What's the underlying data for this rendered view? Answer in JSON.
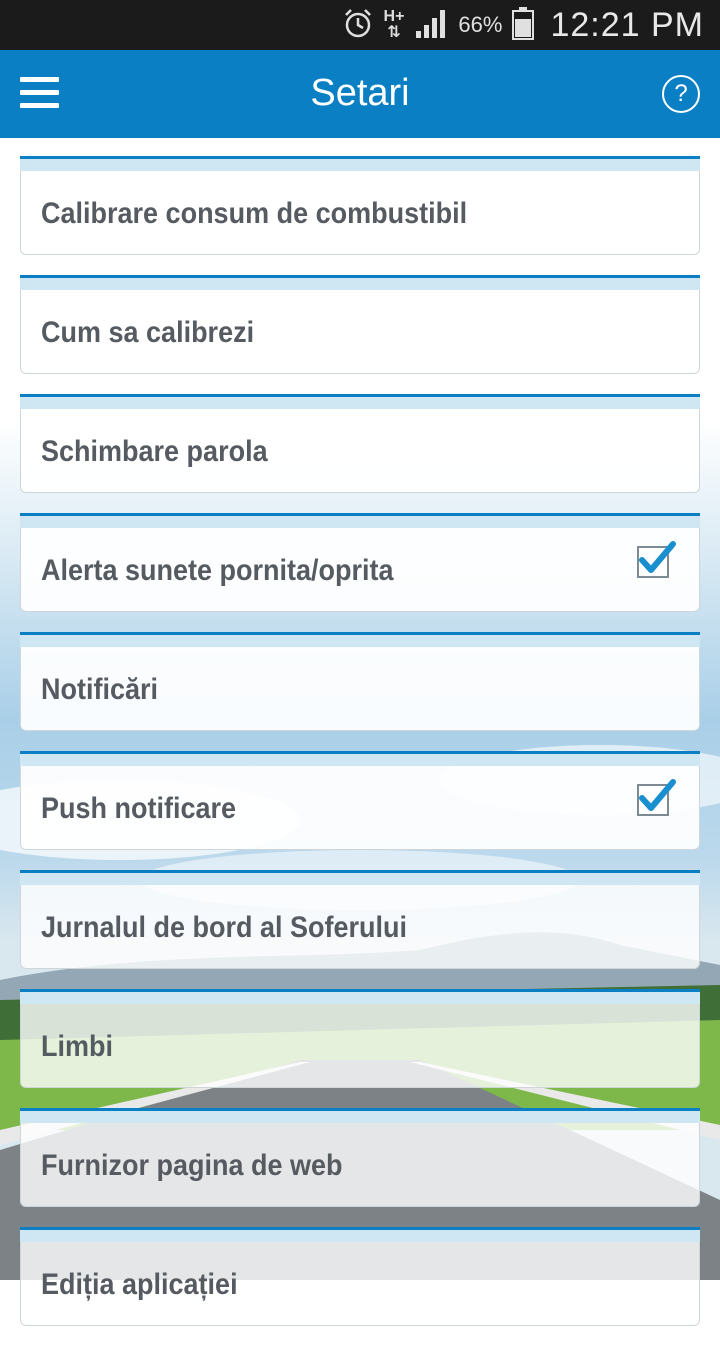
{
  "status_bar": {
    "network": "H+",
    "battery_percent": "66%",
    "time": "12:21 PM",
    "icons": [
      "alarm-icon",
      "network-icon",
      "signal-icon",
      "battery-icon"
    ]
  },
  "app_bar": {
    "title": "Setari",
    "help_symbol": "?",
    "accent_color": "#0a7fc3"
  },
  "settings": [
    {
      "label": "Calibrare consum de combustibil",
      "checkbox": null
    },
    {
      "label": "Cum sa calibrezi",
      "checkbox": null
    },
    {
      "label": "Schimbare parola",
      "checkbox": null
    },
    {
      "label": "Alerta sunete pornita/oprita",
      "checkbox": true
    },
    {
      "label": "Notificări",
      "checkbox": null
    },
    {
      "label": "Push notificare",
      "checkbox": true
    },
    {
      "label": "Jurnalul de bord al Soferului",
      "checkbox": null
    },
    {
      "label": "Limbi",
      "checkbox": null
    },
    {
      "label": "Furnizor pagina de web",
      "checkbox": null
    },
    {
      "label": "Ediția aplicației",
      "checkbox": null
    }
  ]
}
